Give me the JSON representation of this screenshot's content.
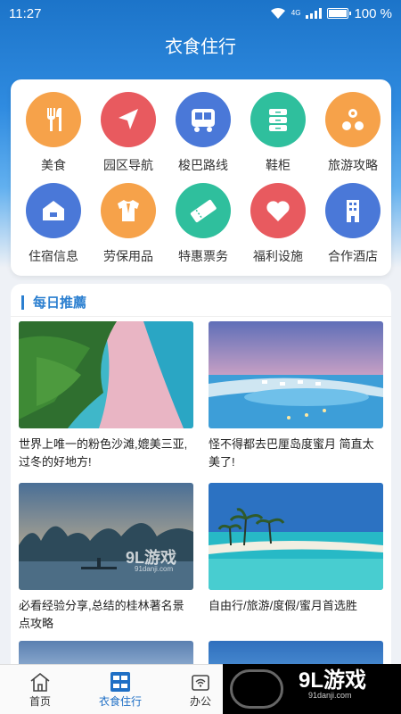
{
  "status": {
    "time": "11:27",
    "network": "4G",
    "battery": "100 %"
  },
  "app": {
    "title": "衣食住行"
  },
  "grid": [
    {
      "label": "美食",
      "icon": "fork-knife-icon",
      "color": "#f6a24a"
    },
    {
      "label": "园区导航",
      "icon": "navigation-arrow-icon",
      "color": "#e85a5f"
    },
    {
      "label": "梭巴路线",
      "icon": "bus-icon",
      "color": "#4a78d8"
    },
    {
      "label": "鞋柜",
      "icon": "cabinet-icon",
      "color": "#2fbf9d"
    },
    {
      "label": "旅游攻略",
      "icon": "travel-guide-icon",
      "color": "#f6a24a"
    },
    {
      "label": "住宿信息",
      "icon": "lodging-icon",
      "color": "#4a78d8"
    },
    {
      "label": "劳保用品",
      "icon": "uniform-icon",
      "color": "#f6a24a"
    },
    {
      "label": "特惠票务",
      "icon": "ticket-icon",
      "color": "#2fbf9d"
    },
    {
      "label": "福利设施",
      "icon": "heart-icon",
      "color": "#e85a5f"
    },
    {
      "label": "合作酒店",
      "icon": "hotel-building-icon",
      "color": "#4a78d8"
    }
  ],
  "recommend": {
    "title": "每日推薦",
    "items": [
      {
        "caption": "世界上唯一的粉色沙滩,媲美三亚,过冬的好地方!"
      },
      {
        "caption": "怪不得都去巴厘岛度蜜月 简直太美了!"
      },
      {
        "caption": "必看经验分享,总结的桂林著名景点攻略"
      },
      {
        "caption": "自由行/旅游/度假/蜜月首选胜"
      }
    ],
    "image_watermark": "9L游戏",
    "image_watermark_url": "91danji.com"
  },
  "tabs": [
    {
      "label": "首页",
      "icon": "home-icon"
    },
    {
      "label": "衣食住行",
      "icon": "lifestyle-grid-icon",
      "active": true
    },
    {
      "label": "办公",
      "icon": "office-icon"
    }
  ],
  "watermark": {
    "logo": "9L游戏",
    "url": "91danji.com"
  }
}
